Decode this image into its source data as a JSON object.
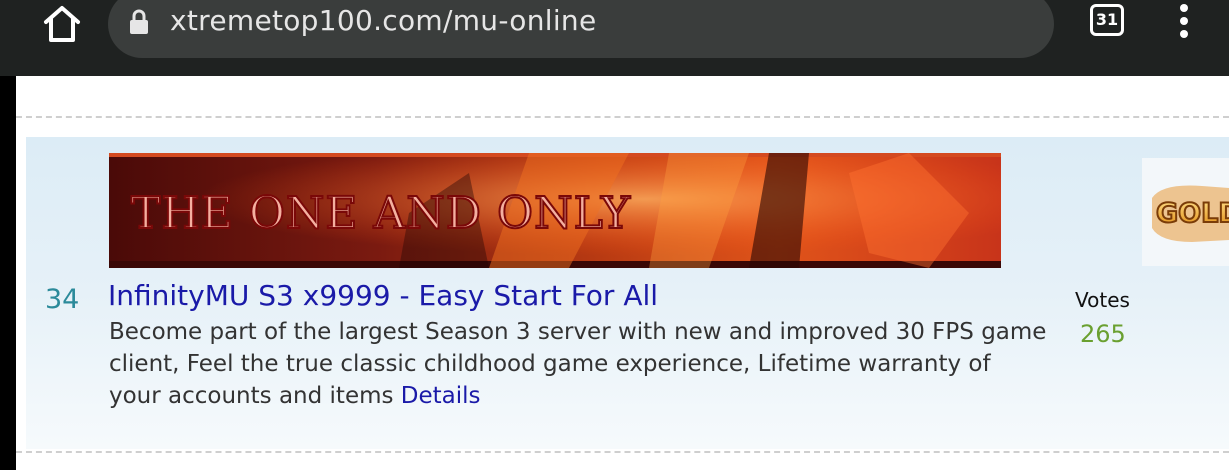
{
  "browser": {
    "url": "xtremetop100.com/mu-online",
    "tab_count": "31",
    "home_icon": "home-icon",
    "lock_icon": "lock-icon",
    "menu_icon": "more-vert-icon"
  },
  "entry": {
    "rank": "34",
    "banner_text": "THE ONE AND ONLY",
    "title": "InfinityMU S3 x9999 - Easy Start For All",
    "description": "Become part of the largest Season 3 server with new and improved 30 FPS game client, Feel the true classic childhood game experience, Lifetime warranty of your accounts and items",
    "details_label": "Details",
    "votes_label": "Votes",
    "votes_count": "265"
  },
  "side_ad": {
    "text": "GOLD"
  }
}
